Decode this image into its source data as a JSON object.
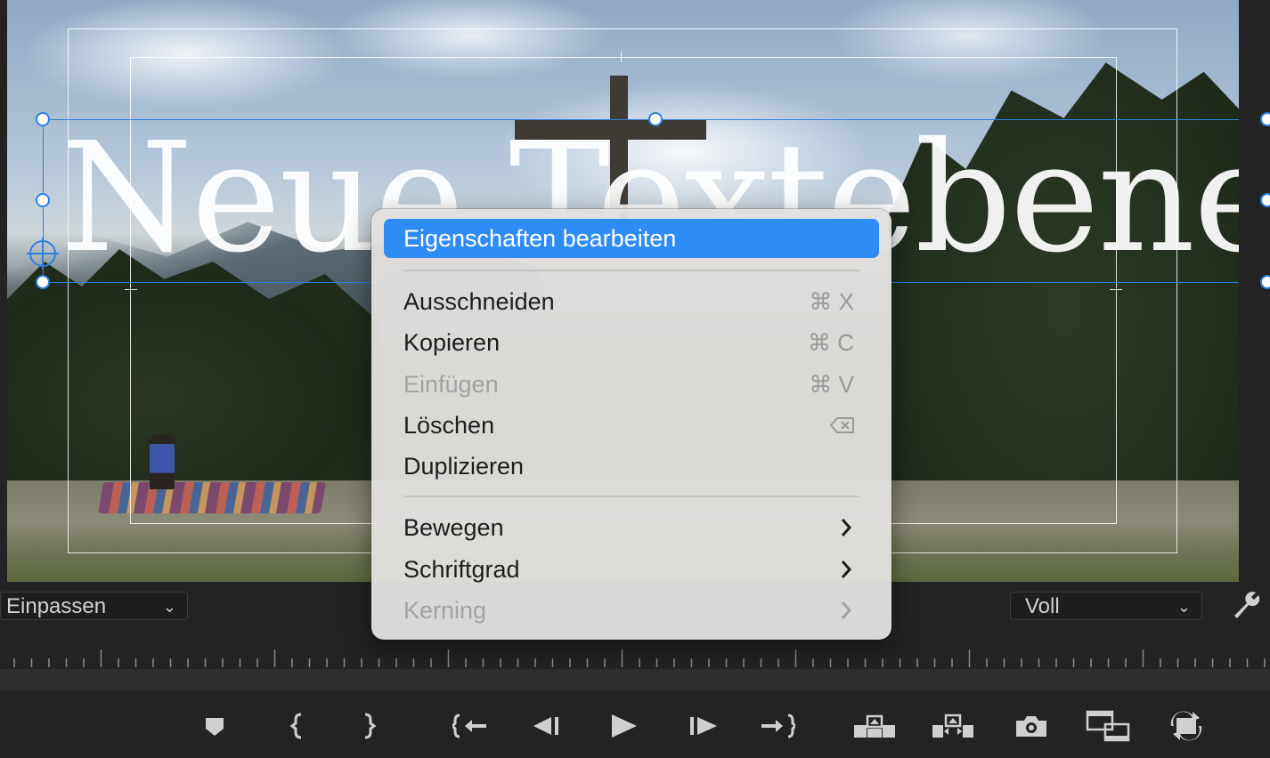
{
  "monitor": {
    "title_text": "Neue Textebene"
  },
  "controls": {
    "zoom_dropdown": "Einpassen",
    "resolution_dropdown": "Voll"
  },
  "context_menu": {
    "items": [
      {
        "label": "Eigenschaften bearbeiten",
        "shortcut": "",
        "state": "highlighted"
      },
      {
        "label": "Ausschneiden",
        "shortcut": "⌘ X",
        "state": "enabled"
      },
      {
        "label": "Kopieren",
        "shortcut": "⌘ C",
        "state": "enabled"
      },
      {
        "label": "Einfügen",
        "shortcut": "⌘ V",
        "state": "disabled"
      },
      {
        "label": "Löschen",
        "shortcut_icon": "delete-key-icon",
        "state": "enabled"
      },
      {
        "label": "Duplizieren",
        "shortcut": "",
        "state": "enabled"
      },
      {
        "label": "Bewegen",
        "submenu": true,
        "state": "enabled"
      },
      {
        "label": "Schriftgrad",
        "submenu": true,
        "state": "enabled"
      },
      {
        "label": "Kerning",
        "submenu": true,
        "state": "disabled"
      }
    ]
  },
  "transport_buttons": [
    "add-marker-icon",
    "mark-in-icon",
    "mark-out-icon",
    "go-to-in-icon",
    "step-back-icon",
    "play-icon",
    "step-forward-icon",
    "go-to-out-icon",
    "lift-icon",
    "extract-icon",
    "export-frame-icon",
    "insert-icon",
    "overwrite-icon"
  ],
  "colors": {
    "selection_blue": "#2e7fe0",
    "menu_highlight": "#2f8cf7",
    "panel_background": "#232323"
  }
}
